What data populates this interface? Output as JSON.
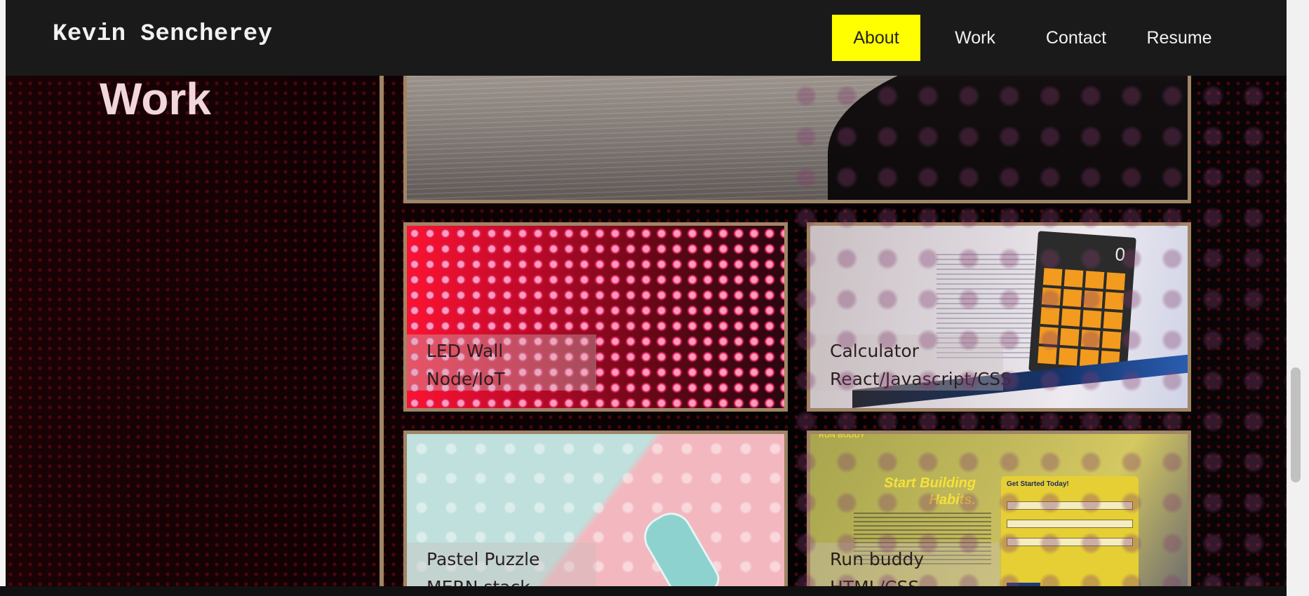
{
  "navbar": {
    "brand": "Kevin Sencherey",
    "items": [
      {
        "label": "About",
        "active": true
      },
      {
        "label": "Work",
        "active": false
      },
      {
        "label": "Contact",
        "active": false
      },
      {
        "label": "Resume",
        "active": false
      }
    ]
  },
  "section": {
    "title": "Work"
  },
  "projects": [
    {
      "title": "LED Wall",
      "stack": "Node/IoT"
    },
    {
      "title": "Calculator",
      "stack": "React/Javascript/CSS",
      "screen_value": "0"
    },
    {
      "title": "Pastel Puzzle",
      "stack": "MERN stack"
    },
    {
      "title": "Run buddy",
      "stack": "HTML/CSS",
      "hero_line1": "Start Building",
      "hero_line2": "Habits.",
      "form_title": "Get Started Today!",
      "brand": "RUN BUDDY"
    }
  ],
  "colors": {
    "nav_background": "#1a1a1a",
    "active_accent": "#ffff00",
    "card_border": "#a08566",
    "title_color": "#f2d6dc"
  }
}
